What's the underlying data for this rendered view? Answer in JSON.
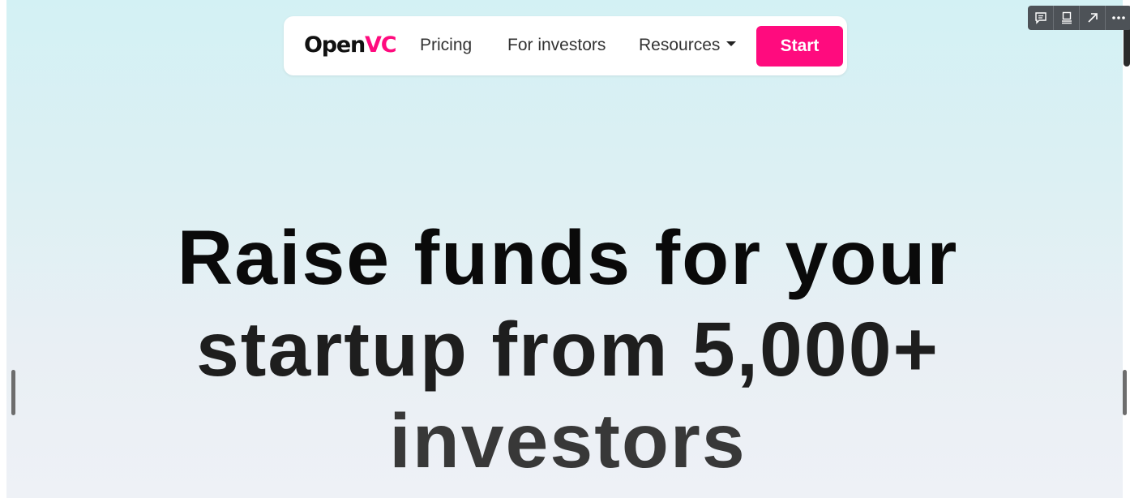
{
  "nav": {
    "logo_part1": "Open",
    "logo_part2": "VC",
    "links": [
      {
        "label": "Pricing"
      },
      {
        "label": "For investors"
      },
      {
        "label": "Resources"
      }
    ],
    "cta_label": "Start"
  },
  "hero": {
    "lines": [
      "Raise funds for your",
      "startup from 5,000+",
      "investors"
    ]
  },
  "toolbar": {
    "icons": [
      "comment-icon",
      "layout-icon",
      "open-external-icon",
      "more-icon"
    ]
  },
  "colors": {
    "brand_pink": "#ff0b7e",
    "background_top": "#d3f1f4",
    "background_bottom": "#eef1f6"
  }
}
